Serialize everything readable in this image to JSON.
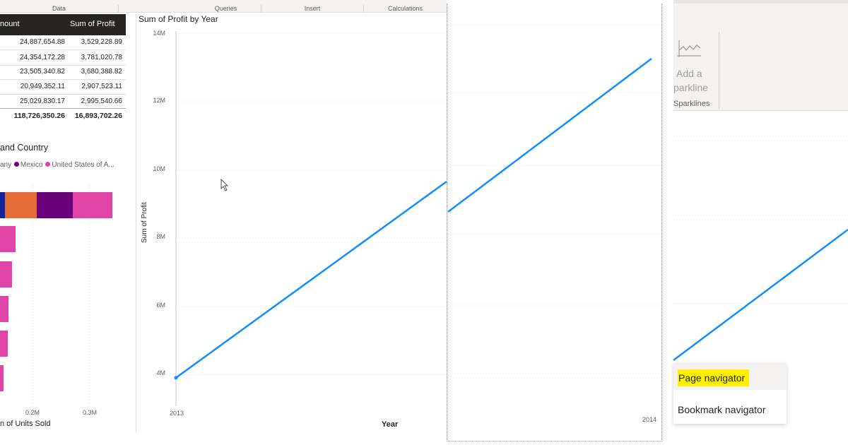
{
  "ribbon_tabs": [
    "Data",
    "Queries",
    "Insert",
    "Calculations"
  ],
  "table": {
    "headers": [
      "nount",
      "Sum of Profit"
    ],
    "rows": [
      [
        "24,887,654.88",
        "3,529,228.89"
      ],
      [
        "24,354,172.28",
        "3,781,020.78"
      ],
      [
        "23,505,340.82",
        "3,680,388.82"
      ],
      [
        "20,949,352.11",
        "2,907,523.11"
      ],
      [
        "25,029,830.17",
        "2,995,540.66"
      ]
    ],
    "total": [
      "118,726,350.26",
      "16,893,702.26"
    ]
  },
  "bar_chart": {
    "title": "and Country",
    "legend": [
      {
        "name": "any",
        "color": "#118dff"
      },
      {
        "name": "Mexico",
        "color": "#6b007b"
      },
      {
        "name": "United States of A...",
        "color": "#e044a7"
      }
    ],
    "x_ticks": [
      "0.2M",
      "0.3M"
    ],
    "x_label": "n of Units Sold",
    "colors": {
      "blue": "#12239e",
      "orange": "#e66c37",
      "purple": "#6b007b",
      "pink": "#e044a7"
    }
  },
  "chart_data": {
    "type": "line",
    "title": "Sum of Profit by Year",
    "xlabel": "Year",
    "ylabel": "Sum of Profit",
    "x": [
      "2013",
      "2014"
    ],
    "y_ticks": [
      "4M",
      "6M",
      "8M",
      "10M",
      "12M",
      "14M"
    ],
    "ylim": [
      3300000,
      14000000
    ],
    "series": [
      {
        "values": [
          3900000,
          13000000
        ]
      }
    ],
    "line_color": "#118dff",
    "grid": true
  },
  "ribbon": {
    "add_sparkline_line1": "Add a",
    "add_sparkline_line2": "parkline",
    "group_label": "Sparklines"
  },
  "menu": {
    "items": [
      "Page navigator",
      "Bookmark navigator"
    ],
    "highlight_color": "#fff000"
  }
}
